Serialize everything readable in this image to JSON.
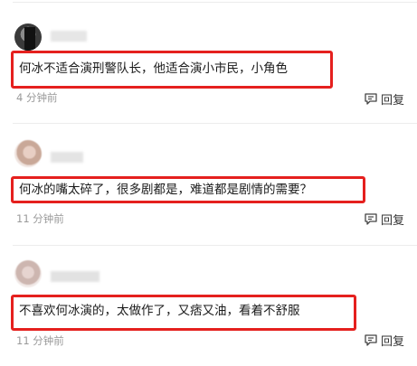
{
  "comments": [
    {
      "username": "",
      "text": "何冰不适合演刑警队长，他适合演小市民，小角色",
      "time": "4 分钟前",
      "reply_label": "回复",
      "reply_icon": "reply-comment-icon"
    },
    {
      "username": "",
      "text": "何冰的嘴太碎了，很多剧都是，难道都是剧情的需要？",
      "time": "11 分钟前",
      "reply_label": "回复",
      "reply_icon": "reply-comment-icon"
    },
    {
      "username": "",
      "text": "不喜欢何冰演的，太做作了，又痞又油，看着不舒服",
      "time": "11 分钟前",
      "reply_label": "回复",
      "reply_icon": "reply-comment-icon"
    }
  ],
  "colors": {
    "highlight_border": "#e5201e",
    "meta_text": "#9a9a9a"
  }
}
